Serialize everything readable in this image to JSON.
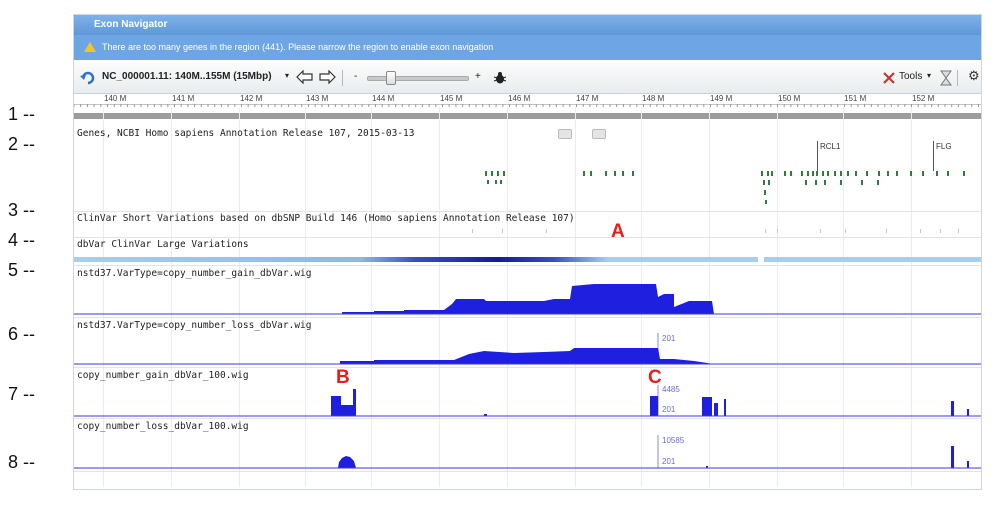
{
  "navigator": {
    "title": "Exon Navigator",
    "warning": "There are too many genes in the region (441). Please narrow the region to enable exon navigation"
  },
  "toolbar": {
    "region": "NC_000001.11: 140M..155M (15Mbp)",
    "zoom_out": "-",
    "zoom_in": "+",
    "tools_label": "Tools"
  },
  "ruler": {
    "ticks": [
      "140 M",
      "141 M",
      "142 M",
      "143 M",
      "144 M",
      "145 M",
      "146 M",
      "147 M",
      "148 M",
      "149 M",
      "150 M",
      "151 M",
      "152 M"
    ]
  },
  "row_numbers": [
    "1 --",
    "2 --",
    "3 --",
    "4 --",
    "5 --",
    "6 --",
    "7 --",
    "8 --"
  ],
  "tracks": {
    "genes": "Genes, NCBI Homo sapiens Annotation Release 107, 2015-03-13",
    "clinvar": "ClinVar Short Variations based on dbSNP Build 146 (Homo sapiens Annotation Release 107)",
    "dbvar": "dbVar ClinVar Large Variations",
    "gain_wig": "nstd37.VarType=copy_number_gain_dbVar.wig",
    "loss_wig": "nstd37.VarType=copy_number_loss_dbVar.wig",
    "gain_100": "copy_number_gain_dbVar_100.wig",
    "loss_100": "copy_number_loss_dbVar_100.wig"
  },
  "gene_labels": [
    "RCL1",
    "FLG"
  ],
  "scale_labels": {
    "loss_max": "201",
    "gain100_max": "4485",
    "gain100_mid": "201",
    "loss100_max": "10585",
    "loss100_mid": "201"
  },
  "markers": [
    "A",
    "B",
    "C"
  ],
  "colors": {
    "accent": "#5e97d8",
    "signal": "#1f1fe0",
    "marker": "#e51d1d"
  }
}
